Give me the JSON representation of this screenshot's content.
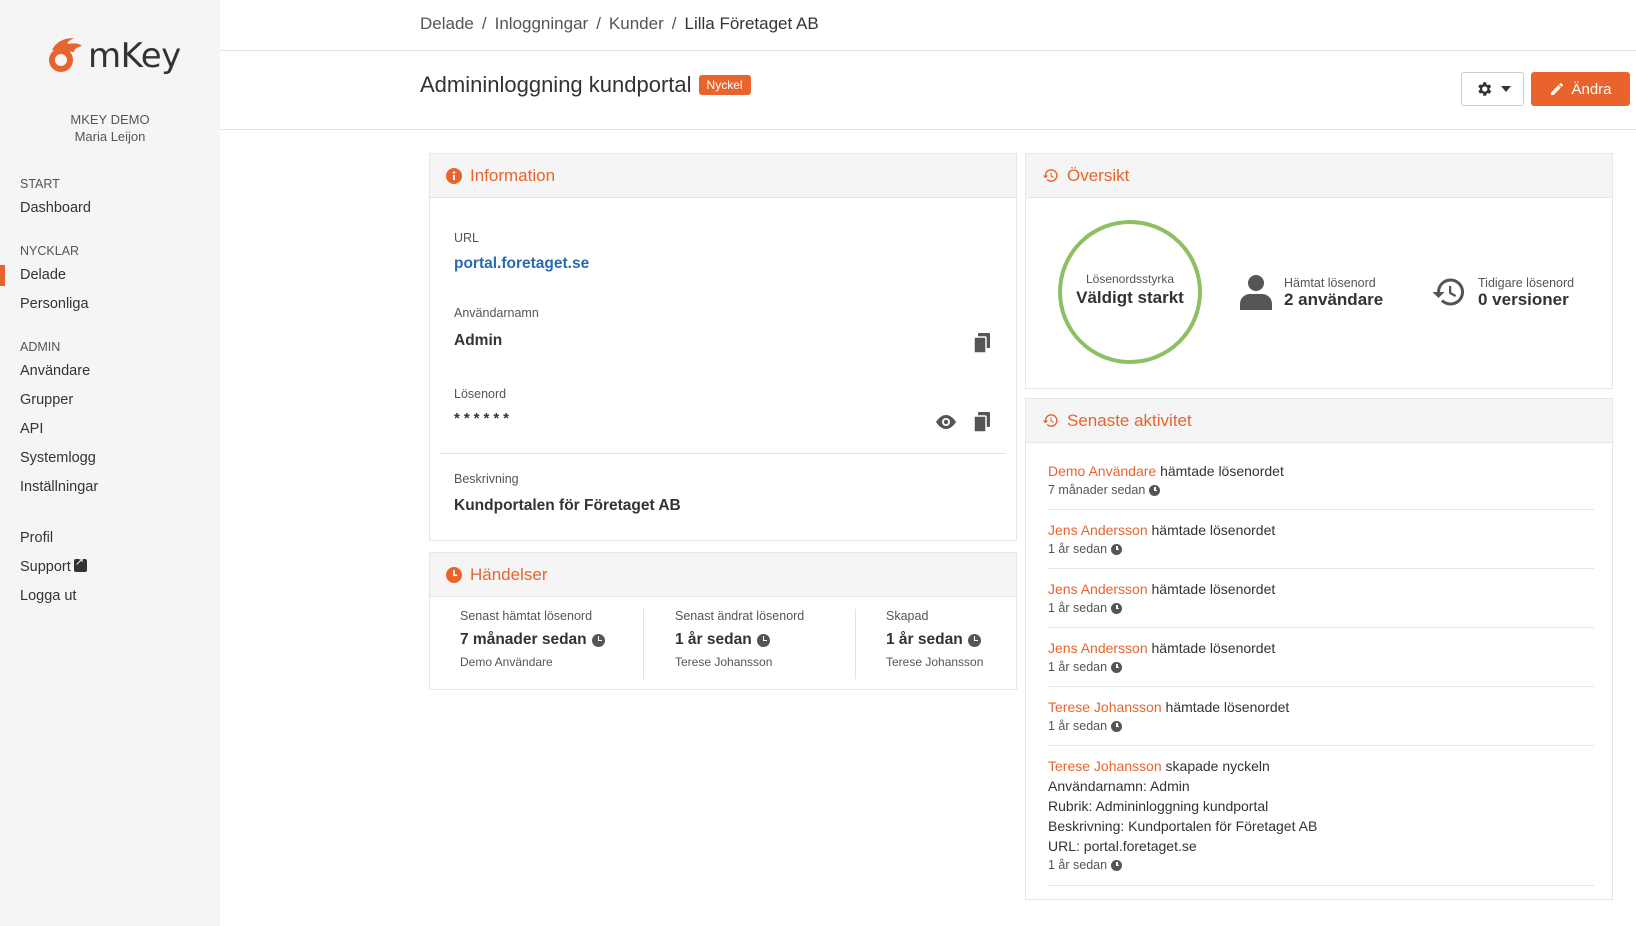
{
  "app": {
    "logo_text": "mKey",
    "org_name": "MKEY DEMO",
    "user_name": "Maria Leijon",
    "brand_color": "#e8642c"
  },
  "nav": {
    "sections": [
      {
        "title": "START",
        "items": [
          {
            "label": "Dashboard"
          }
        ]
      },
      {
        "title": "NYCKLAR",
        "items": [
          {
            "label": "Delade",
            "active": true
          },
          {
            "label": "Personliga"
          }
        ]
      },
      {
        "title": "ADMIN",
        "items": [
          {
            "label": "Användare"
          },
          {
            "label": "Grupper"
          },
          {
            "label": "API"
          },
          {
            "label": "Systemlogg"
          },
          {
            "label": "Inställningar"
          }
        ]
      }
    ],
    "footer": {
      "profile": "Profil",
      "support": "Support",
      "logout": "Logga ut"
    }
  },
  "breadcrumb": [
    "Delade",
    "Inloggningar",
    "Kunder",
    "Lilla Företaget AB"
  ],
  "page": {
    "title": "Admininloggning kundportal",
    "badge": "Nyckel",
    "edit_label": "Ändra"
  },
  "information": {
    "heading": "Information",
    "url_label": "URL",
    "url_value": "portal.foretaget.se",
    "username_label": "Användarnamn",
    "username_value": "Admin",
    "password_label": "Lösenord",
    "password_value": "******",
    "description_label": "Beskrivning",
    "description_value": "Kundportalen för Företaget AB"
  },
  "events": {
    "heading": "Händelser",
    "columns": [
      {
        "label": "Senast hämtat lösenord",
        "value": "7 månader sedan",
        "by": "Demo Användare"
      },
      {
        "label": "Senast ändrat lösenord",
        "value": "1 år sedan",
        "by": "Terese Johansson"
      },
      {
        "label": "Skapad",
        "value": "1 år sedan",
        "by": "Terese Johansson"
      }
    ]
  },
  "overview": {
    "heading": "Översikt",
    "strength_label": "Lösenordsstyrka",
    "strength_value": "Väldigt starkt",
    "strength_color": "#8cc063",
    "fetched_label": "Hämtat lösenord",
    "fetched_value": "2 användare",
    "history_label": "Tidigare lösenord",
    "history_value": "0 versioner"
  },
  "activity": {
    "heading": "Senaste aktivitet",
    "items": [
      {
        "user": "Demo Användare",
        "action": " hämtade lösenordet",
        "time": "7 månader sedan"
      },
      {
        "user": "Jens Andersson",
        "action": " hämtade lösenordet",
        "time": "1 år sedan"
      },
      {
        "user": "Jens Andersson",
        "action": " hämtade lösenordet",
        "time": "1 år sedan"
      },
      {
        "user": "Jens Andersson",
        "action": " hämtade lösenordet",
        "time": "1 år sedan"
      },
      {
        "user": "Terese Johansson",
        "action": " hämtade lösenordet",
        "time": "1 år sedan"
      },
      {
        "user": "Terese Johansson",
        "action": " skapade nyckeln",
        "time": "1 år sedan",
        "details": [
          {
            "key": "Användarnamn: ",
            "value": "Admin"
          },
          {
            "key": "Rubrik: ",
            "value": "Admininloggning kundportal"
          },
          {
            "key": "Beskrivning: ",
            "value": "Kundportalen för Företaget AB"
          },
          {
            "key": "URL: ",
            "value": "portal.foretaget.se"
          }
        ]
      }
    ]
  }
}
